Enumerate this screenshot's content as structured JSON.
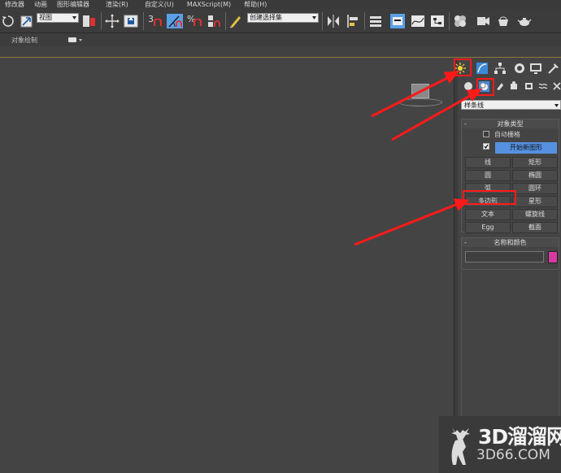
{
  "menu": [
    "修改器",
    "动画",
    "图形编辑器",
    "渲染(R)",
    "自定义(U)",
    "MAXScript(M)",
    "帮助(H)"
  ],
  "toolbar": {
    "view_dropdown": "视图",
    "selection_set_dropdown": "创建选择集",
    "snap_3": "3",
    "percent_snap": "%"
  },
  "row2": {
    "label": "对象绘制"
  },
  "panel": {
    "category_dropdown": "样条线",
    "object_type": {
      "title": "对象类型",
      "auto_grid": "自动栅格",
      "start_new_shape": "开始新图形",
      "buttons": [
        [
          "线",
          "矩形"
        ],
        [
          "圆",
          "椭圆"
        ],
        [
          "弧",
          "圆环"
        ],
        [
          "多边形",
          "星形"
        ],
        [
          "文本",
          "螺旋线"
        ],
        [
          "Egg",
          "截面"
        ]
      ]
    },
    "name_color": {
      "title": "名称和颜色",
      "name_value": "",
      "color": "#d43aa0"
    }
  },
  "colors": {
    "highlight": "#ff1a1a",
    "active_blue": "#5591e0"
  },
  "watermark": {
    "main": "3D溜溜网",
    "sub": "3D66.COM"
  }
}
